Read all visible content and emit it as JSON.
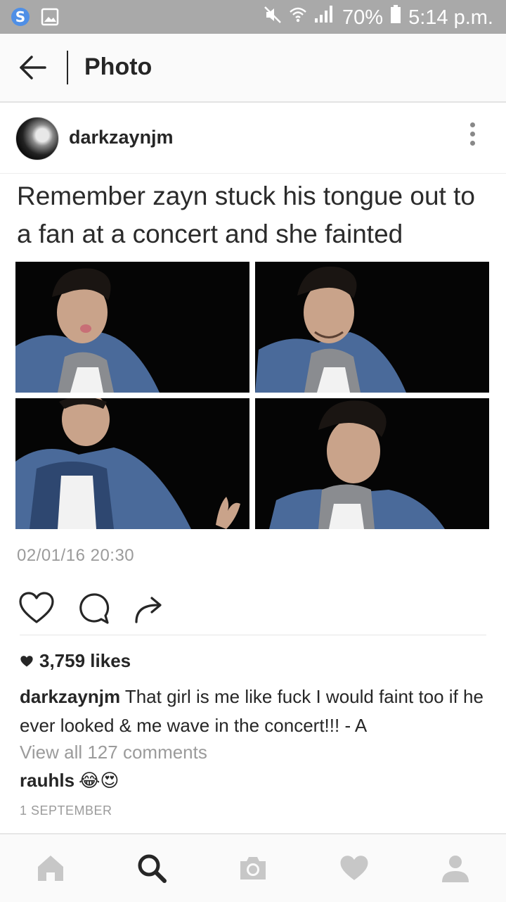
{
  "status_bar": {
    "battery": "70%",
    "time": "5:14 p.m."
  },
  "app_bar": {
    "title": "Photo"
  },
  "post": {
    "username": "darkzaynjm",
    "photo_caption": "Remember zayn stuck his tongue out to a fan at a concert and she fainted",
    "photo_timestamp": "02/01/16 20:30",
    "likes": "3,759 likes",
    "caption_username": "darkzaynjm",
    "caption_text": "That girl is me like fuck I would faint too if he ever looked & me wave in the concert!!! - A",
    "view_comments": "View all 127 comments",
    "comments": [
      {
        "username": "rauhls",
        "text": "😂😍"
      }
    ],
    "date": "1 SEPTEMBER"
  },
  "icons": {
    "status_left": [
      "skype-icon",
      "gallery-icon"
    ],
    "status_right": [
      "mute-icon",
      "wifi-icon",
      "signal-icon",
      "battery-icon"
    ],
    "actions": [
      "heart-icon",
      "comment-icon",
      "share-icon"
    ],
    "bottom_nav": [
      "home-icon",
      "search-icon",
      "camera-icon",
      "heart-icon",
      "profile-icon"
    ]
  },
  "colors": {
    "status_bar": "#a9a9a9",
    "text": "#262626",
    "muted": "#9b9b9b",
    "nav_inactive": "#c7c7c7",
    "nav_active": "#262626"
  }
}
